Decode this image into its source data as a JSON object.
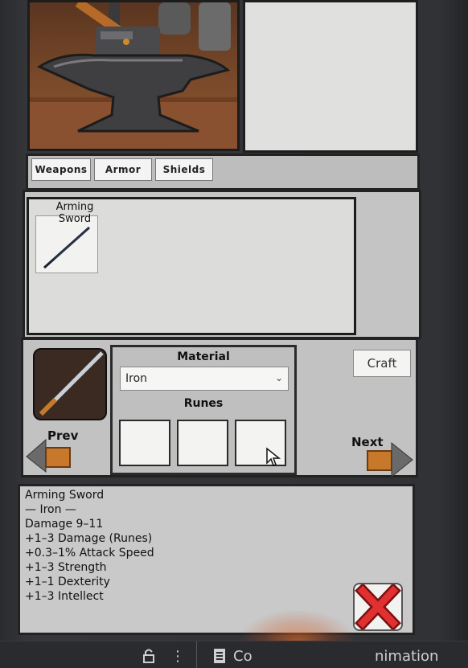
{
  "tabs": [
    {
      "label": "Weapons"
    },
    {
      "label": "Armor"
    },
    {
      "label": "Shields"
    }
  ],
  "selected_item": {
    "name": "Arming\nSword"
  },
  "craft": {
    "material_label": "Material",
    "material_value": "Iron",
    "runes_label": "Runes",
    "craft_label": "Craft",
    "prev_label": "Prev",
    "next_label": "Next"
  },
  "stats": [
    "Arming Sword",
    "— Iron —",
    "Damage  9–11",
    "+1–3 Damage (Runes)",
    "+0.3–1% Attack Speed",
    "+1–3 Strength",
    "+1–1 Dexterity",
    "+1–3 Intellect"
  ],
  "bottom_bar": {
    "left_tab": "Co",
    "right_tab": "nimation"
  },
  "colors": {
    "panel_bg": "#c8c8c8",
    "border": "#222222",
    "close_x": "#d42b2b",
    "arrow_wood": "#c8782a"
  },
  "icons": [
    "anvil-hammer-icon",
    "sword-icon",
    "close-x-icon",
    "arrow-left-icon",
    "arrow-right-icon",
    "cursor-icon",
    "lock-icon",
    "more-icon",
    "document-icon"
  ]
}
